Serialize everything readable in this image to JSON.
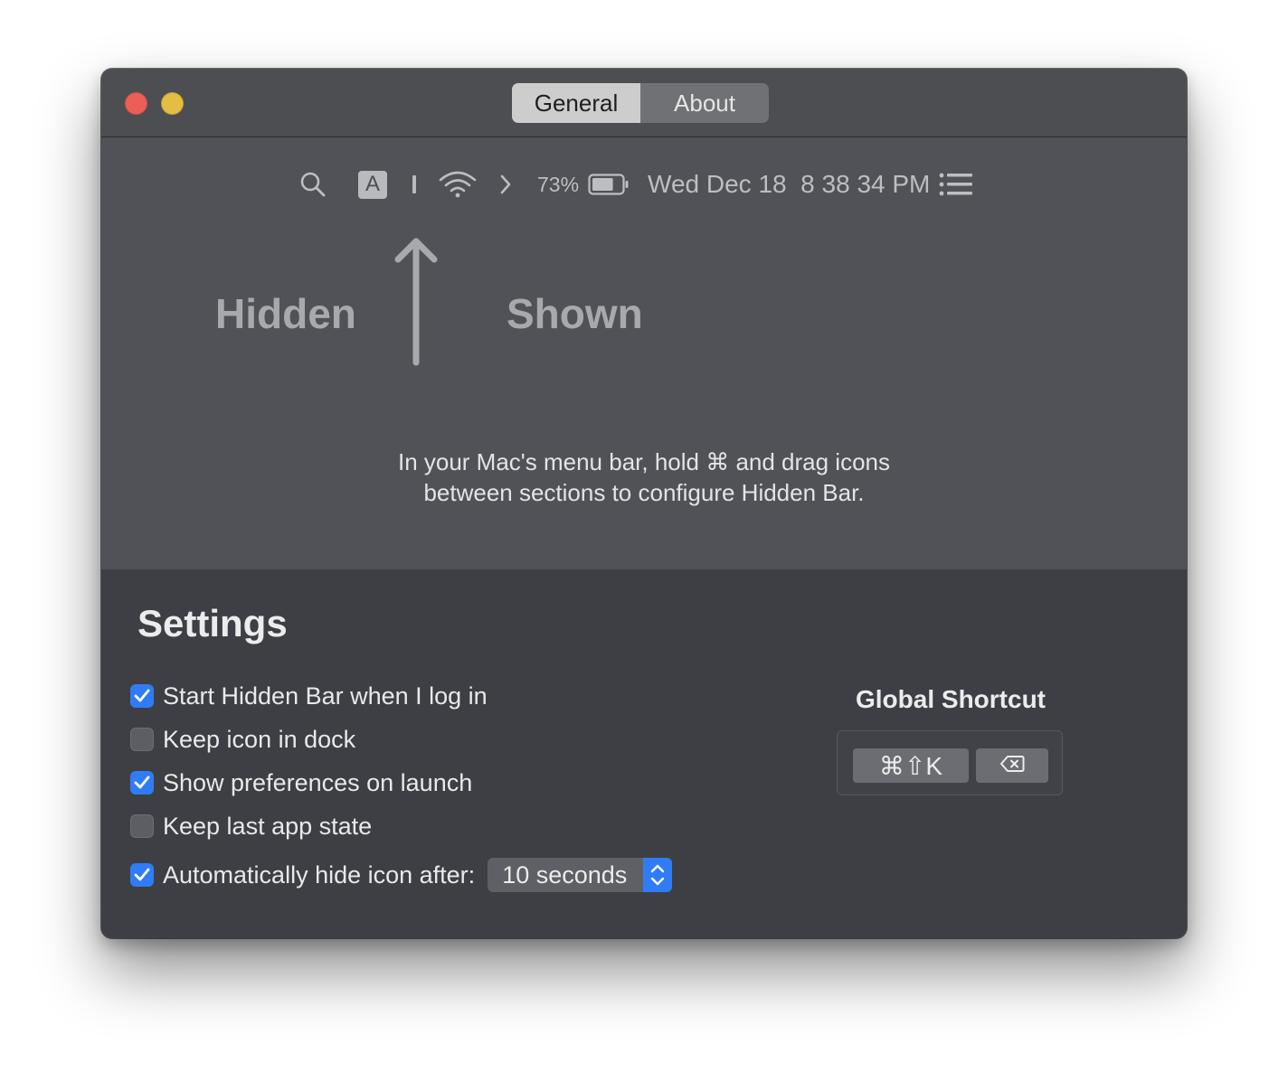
{
  "window": {
    "tabs": [
      {
        "label": "General",
        "active": true
      },
      {
        "label": "About",
        "active": false
      }
    ]
  },
  "menubar_preview": {
    "icons": [
      "search-icon",
      "input-source-icon",
      "separator-icon",
      "wifi-icon",
      "expand-chevron-icon",
      "battery-icon",
      "list-icon"
    ],
    "input_letter": "A",
    "battery_percent": "73%",
    "battery_level": 0.73,
    "datetime": "Wed Dec 18  8 38 34 PM"
  },
  "sections": {
    "hidden_label": "Hidden",
    "shown_label": "Shown"
  },
  "instructions": {
    "line1": "In your Mac's menu bar, hold ⌘ and drag icons",
    "line2": "between sections to configure Hidden Bar."
  },
  "settings": {
    "title": "Settings",
    "options": [
      {
        "label": "Start Hidden Bar when I log in",
        "checked": true
      },
      {
        "label": "Keep icon in dock",
        "checked": false
      },
      {
        "label": "Show preferences on launch",
        "checked": true
      },
      {
        "label": "Keep last app state",
        "checked": false
      }
    ],
    "auto_hide": {
      "label": "Automatically hide icon after:",
      "checked": true,
      "selected": "10 seconds"
    }
  },
  "shortcut": {
    "title": "Global Shortcut",
    "keys": "⌘⇧K",
    "clear_icon": "delete-left-icon"
  },
  "colors": {
    "accent": "#2f7cf6",
    "close": "#ec5f56",
    "minimize": "#e4bd43"
  }
}
